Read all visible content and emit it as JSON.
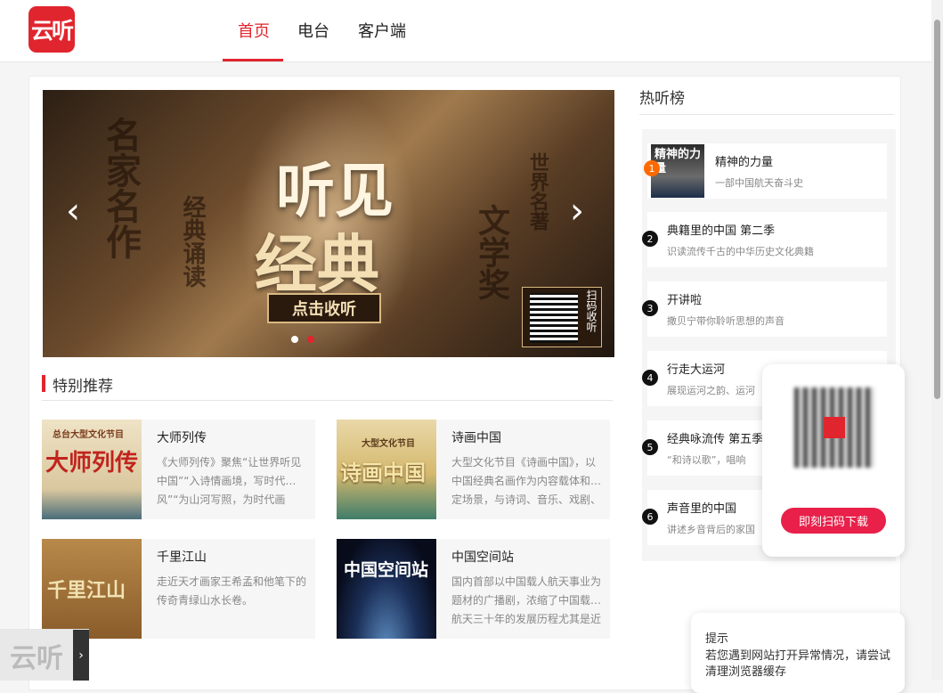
{
  "header": {
    "logo_text": "云听",
    "nav": [
      {
        "label": "首页",
        "active": true
      },
      {
        "label": "电台",
        "active": false
      },
      {
        "label": "客户端",
        "active": false
      }
    ]
  },
  "banner": {
    "title_top": "听见",
    "title_main": "经典",
    "side_left": "名家名作",
    "side_left2": "经典诵读",
    "side_right": "世界名著",
    "side_right2": "文学奖",
    "cta": "点击收听",
    "qr_caption": "扫码收听",
    "prev_icon": "chevron-left-icon",
    "next_icon": "chevron-right-icon",
    "dots": [
      {
        "active": false
      },
      {
        "active": true
      }
    ]
  },
  "special": {
    "title": "特别推荐",
    "items": [
      {
        "title": "大师列传",
        "cover_text": "大师列传",
        "cover_caption": "总台大型文化节目",
        "desc": "《大师列传》聚焦“让世界听见中国”“入诗情画境，写时代…风”“为山河写照，为时代画"
      },
      {
        "title": "诗画中国",
        "cover_text": "诗画中国",
        "cover_caption": "大型文化节目",
        "desc": "大型文化节目《诗画中国》，以中国经典名画作为内容载体和…定场景，与诗词、音乐、戏剧、"
      },
      {
        "title": "千里江山",
        "cover_text": "千里江山",
        "cover_caption": "",
        "desc": "走近天才画家王希孟和他笔下的传奇青绿山水长卷。"
      },
      {
        "title": "中国空间站",
        "cover_text": "中国空间站",
        "cover_caption": "",
        "desc": "国内首部以中国载人航天事业为题材的广播剧，浓缩了中国载…航天三十年的发展历程尤其是近"
      }
    ]
  },
  "hot": {
    "title": "热听榜",
    "items": [
      {
        "rank": "1",
        "name": "精神的力量",
        "desc": "一部中国航天奋斗史",
        "cover_text": "精神的力量"
      },
      {
        "rank": "2",
        "name": "典籍里的中国  第二季",
        "desc": "识读流传千古的中华历史文化典籍"
      },
      {
        "rank": "3",
        "name": "开讲啦",
        "desc": "撒贝宁带你聆听思想的声音"
      },
      {
        "rank": "4",
        "name": "行走大运河",
        "desc": "展现运河之韵、运河"
      },
      {
        "rank": "5",
        "name": "经典咏流传  第五季",
        "desc": "“和诗以歌”，唱响"
      },
      {
        "rank": "6",
        "name": "声音里的中国",
        "desc": "讲述乡音背后的家国"
      }
    ]
  },
  "qr_popup": {
    "button": "即刻扫码下载"
  },
  "tip": {
    "title": "提示",
    "text": "若您遇到网站打开异常情况，请尝试清理浏览器缓存"
  },
  "player": {
    "logo_text": "云听",
    "toggle_icon": "chevron-right-icon"
  },
  "colors": {
    "brand": "#e1252e",
    "download": "#e8204a"
  }
}
